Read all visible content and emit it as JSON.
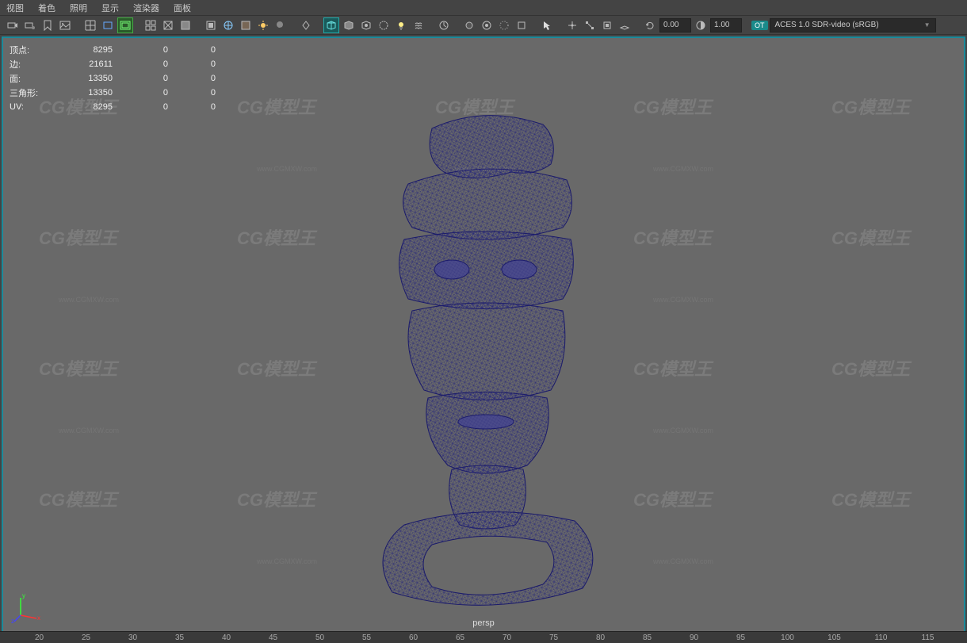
{
  "menubar": {
    "items": [
      "视图",
      "着色",
      "照明",
      "显示",
      "渲染器",
      "面板"
    ]
  },
  "toolbar": {
    "field1": "0.00",
    "field2": "1.00",
    "ot_label": "OT",
    "colorspace": "ACES 1.0 SDR-video (sRGB)"
  },
  "hud": {
    "rows": [
      {
        "label": "顶点:",
        "v1": "8295",
        "v2": "0",
        "v3": "0"
      },
      {
        "label": "边:",
        "v1": "21611",
        "v2": "0",
        "v3": "0"
      },
      {
        "label": "面:",
        "v1": "13350",
        "v2": "0",
        "v3": "0"
      },
      {
        "label": "三角形:",
        "v1": "13350",
        "v2": "0",
        "v3": "0"
      },
      {
        "label": "UV:",
        "v1": "8295",
        "v2": "0",
        "v3": "0"
      }
    ]
  },
  "camera_label": "persp",
  "axis": {
    "x": "x",
    "y": "y",
    "z": "z"
  },
  "watermark_text": "CG模型王",
  "watermark_url": "www.CGMXW.com",
  "ruler": [
    "20",
    "25",
    "30",
    "35",
    "40",
    "45",
    "50",
    "55",
    "60",
    "65",
    "70",
    "75",
    "80",
    "85",
    "90",
    "95",
    "100",
    "105",
    "110",
    "115"
  ]
}
